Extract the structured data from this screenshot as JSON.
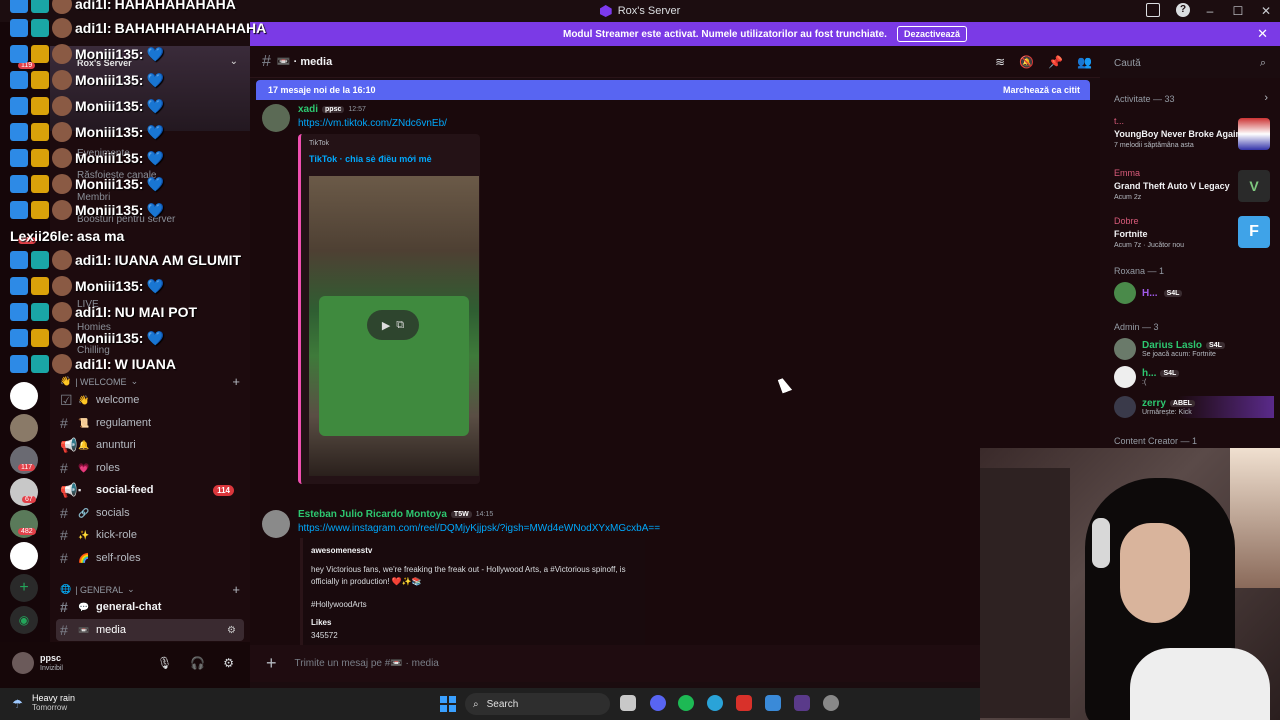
{
  "window": {
    "title": "Rox's Server"
  },
  "banner": {
    "text": "Modul Streamer este activat. Numele utilizatorilor au fost trunchiate.",
    "button": "Dezactivează"
  },
  "overlay_chat": [
    {
      "user": "adi1l:",
      "text": "HAHAHAHAHAHA"
    },
    {
      "user": "adi1l:",
      "text": "BAHAHHAHAHAHAHA"
    },
    {
      "user": "Moniii135:",
      "text": ""
    },
    {
      "user": "Moniii135:",
      "text": ""
    },
    {
      "user": "Moniii135:",
      "text": ""
    },
    {
      "user": "Moniii135:",
      "text": ""
    },
    {
      "user": "Moniii135:",
      "text": ""
    },
    {
      "user": "Moniii135:",
      "text": ""
    },
    {
      "user": "Moniii135:",
      "text": ""
    },
    {
      "user": "Lexii26le:",
      "text": "asa ma"
    },
    {
      "user": "adi1l:",
      "text": "IUANA AM GLUMIT"
    },
    {
      "user": "Moniii135:",
      "text": ""
    },
    {
      "user": "adi1l:",
      "text": "NU MAI POT"
    },
    {
      "user": "Moniii135:",
      "text": ""
    },
    {
      "user": "adi1l:",
      "text": "W IUANA"
    }
  ],
  "rail": {
    "badges": [
      "119",
      "107",
      "117",
      "67",
      "482"
    ]
  },
  "sidebar": {
    "server_name": "Rox's Server",
    "ghost_items": [
      "Evenimente",
      "Răsfoiește canale",
      "Membri",
      "Boosturi pentru server",
      "LIVE",
      "Homies",
      "Chilling"
    ],
    "categories": {
      "welcome": "| WELCOME",
      "general": "| GENERAL"
    },
    "channels": [
      {
        "name": "welcome",
        "emoji": "👋"
      },
      {
        "name": "regulament",
        "emoji": "📜"
      },
      {
        "name": "anunturi",
        "emoji": "🔔"
      },
      {
        "name": "roles",
        "emoji": "💗"
      },
      {
        "name": "social-feed",
        "emoji": "▪",
        "mentions": "114"
      },
      {
        "name": "socials",
        "emoji": "🔗"
      },
      {
        "name": "kick-role",
        "emoji": "✨"
      },
      {
        "name": "self-roles",
        "emoji": "🌈"
      },
      {
        "name": "general-chat",
        "emoji": "💬"
      },
      {
        "name": "media",
        "emoji": "📼"
      }
    ]
  },
  "user": {
    "name": "ppsc",
    "status": "Invizibil"
  },
  "channel": {
    "name": "media",
    "prefix": "📼 ·"
  },
  "search": {
    "placeholder": "Caută"
  },
  "newbar": {
    "text": "17 mesaje noi de la 16:10",
    "action": "Marchează ca citit"
  },
  "messages": [
    {
      "author": "xadi",
      "tag": "ppsc",
      "time": "12:57",
      "link": "https://vm.tiktok.com/ZNdc6vnEb/",
      "embed_provider": "TikTok",
      "embed_title": "TikTok · chia sẻ điều mới mẻ"
    },
    {
      "author": "Esteban Julio Ricardo Montoya",
      "tag": "T5W",
      "time": "14:15",
      "link": "https://www.instagram.com/reel/DQMjyKjjpsk/?igsh=MWd4eWNodXYxMGcxbA==",
      "embed_author": "awesomenesstv",
      "embed_text": "hey Victorious fans, we're freaking the freak out - Hollywood Arts, a #Victorious spinoff, is officially in production! ❤️✨📚",
      "embed_tag": "#HollywoodArts",
      "likes_label": "Likes",
      "likes_value": "345572"
    }
  ],
  "composer": {
    "placeholder": "Trimite un mesaj pe #📼 · media"
  },
  "members": {
    "activity_header": "Activitate — 33",
    "activities": [
      {
        "name": "t...",
        "title": "YoungBoy Never Broke Again",
        "sub": "7 melodii săptămâna asta"
      },
      {
        "name": "Emma",
        "title": "Grand Theft Auto V Legacy",
        "sub": "Acum 2z"
      },
      {
        "name": "Dobre",
        "title": "Fortnite",
        "sub": "Acum 7z · Jucător nou"
      }
    ],
    "roxana_header": "Roxana — 1",
    "roxana_members": [
      {
        "name": "H...",
        "tag": "S4L"
      }
    ],
    "admin_header": "Admin — 3",
    "admins": [
      {
        "name": "Darius Laslo",
        "tag": "S4L",
        "sub": "Se joacă acum: Fortnite"
      },
      {
        "name": "h...",
        "tag": "S4L",
        "sub": ":("
      },
      {
        "name": "zerry",
        "tag": "ABEL",
        "sub": "Urmărește: Kick"
      }
    ],
    "creator_header": "Content Creator — 1"
  },
  "taskbar": {
    "weather_title": "Heavy rain",
    "weather_sub": "Tomorrow",
    "search": "Search"
  }
}
